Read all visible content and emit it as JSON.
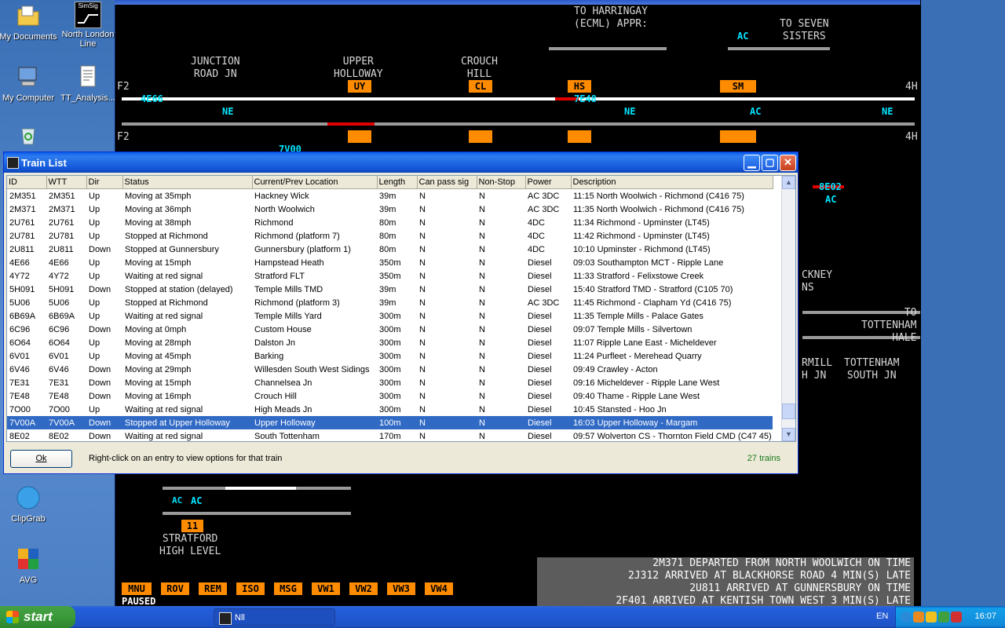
{
  "desktop": {
    "icons": [
      {
        "label": "My Documents",
        "name": "my-documents-icon"
      },
      {
        "label": "North London Line",
        "name": "simsig-icon"
      },
      {
        "label": "My Computer",
        "name": "my-computer-icon"
      },
      {
        "label": "TT_Analysis...",
        "name": "text-file-icon"
      },
      {
        "label": "ClipGrab",
        "name": "clipgrab-icon"
      },
      {
        "label": "AVG",
        "name": "avg-icon"
      }
    ],
    "simsig_icon_text": "SimSig"
  },
  "sim": {
    "labels": {
      "to_harringay": "TO HARRINGAY\n(ECML) APPR:",
      "to_seven_sisters": "TO SEVEN\nSISTERS",
      "junction_road": "JUNCTION\nROAD JN",
      "upper_holloway": "UPPER\nHOLLOWAY",
      "crouch_hill": "CROUCH\nHILL",
      "stratford_high_level": "STRATFORD\nHIGH LEVEL",
      "tottenham_south": "TOTTENHAM\nSOUTH JN",
      "to_tottenham_hale": "TO\nTOTTENHAM\nHALE",
      "hackney": "CKNEY\nNS",
      "rmill": "RMILL\nH JN",
      "harringay_partial": "HARRINGAY",
      "south_partial": "SOUTH",
      "f2_top": "F2",
      "f2_bottom": "F2",
      "h4_top": "4H",
      "h4_bottom": "4H"
    },
    "platforms": {
      "uy": "UY",
      "cl": "CL",
      "hs": "HS",
      "sm": "SM",
      "p11": "11"
    },
    "berths": {
      "b_4e66": "4E66",
      "b_7e48": "7E48",
      "b_8e02": "8E02",
      "b_7v00": "7V00",
      "ne1": "NE",
      "ne2": "NE",
      "ne3": "NE",
      "ac1": "AC",
      "ac2": "AC",
      "ac3": "AC",
      "ac4": "AC",
      "ac5": "AC"
    },
    "menu": [
      "MNU",
      "ROV",
      "REM",
      "ISO",
      "MSG",
      "VW1",
      "VW2",
      "VW3",
      "VW4"
    ],
    "status": "PAUSED",
    "messages": [
      "2M371 DEPARTED FROM NORTH WOOLWICH ON TIME",
      "2J312 ARRIVED AT BLACKHORSE ROAD 4 MIN(S) LATE",
      "2U811 ARRIVED AT GUNNERSBURY ON TIME",
      "2F401 ARRIVED AT KENTISH TOWN WEST 3 MIN(S) LATE"
    ]
  },
  "dialog": {
    "title": "Train List",
    "columns": [
      "ID",
      "WTT",
      "Dir",
      "Status",
      "Current/Prev Location",
      "Length",
      "Can pass sig",
      "Non-Stop",
      "Power",
      "Description"
    ],
    "rows": [
      [
        "2M351",
        "2M351",
        "Up",
        "Moving at 35mph",
        "Hackney Wick",
        "39m",
        "N",
        "N",
        "AC 3DC",
        "11:15 North Woolwich - Richmond (C416 75)"
      ],
      [
        "2M371",
        "2M371",
        "Up",
        "Moving at 36mph",
        "North Woolwich",
        "39m",
        "N",
        "N",
        "AC 3DC",
        "11:35 North Woolwich - Richmond (C416 75)"
      ],
      [
        "2U761",
        "2U761",
        "Up",
        "Moving at 38mph",
        "Richmond",
        "80m",
        "N",
        "N",
        "4DC",
        "11:34 Richmond - Upminster (LT45)"
      ],
      [
        "2U781",
        "2U781",
        "Up",
        "Stopped at Richmond",
        "Richmond (platform 7)",
        "80m",
        "N",
        "N",
        "4DC",
        "11:42 Richmond - Upminster (LT45)"
      ],
      [
        "2U811",
        "2U811",
        "Down",
        "Stopped at Gunnersbury",
        "Gunnersbury (platform 1)",
        "80m",
        "N",
        "N",
        "4DC",
        "10:10 Upminster - Richmond (LT45)"
      ],
      [
        "4E66",
        "4E66",
        "Up",
        "Moving at 15mph",
        "Hampstead Heath",
        "350m",
        "N",
        "N",
        "Diesel",
        "09:03 Southampton MCT - Ripple Lane"
      ],
      [
        "4Y72",
        "4Y72",
        "Up",
        "Waiting at red signal",
        "Stratford FLT",
        "350m",
        "N",
        "N",
        "Diesel",
        "11:33 Stratford - Felixstowe Creek"
      ],
      [
        "5H091",
        "5H091",
        "Down",
        "Stopped at station (delayed)",
        "Temple Mills TMD",
        "39m",
        "N",
        "N",
        "Diesel",
        "15:40 Stratford TMD - Stratford (C105 70)"
      ],
      [
        "5U06",
        "5U06",
        "Up",
        "Stopped at Richmond",
        "Richmond (platform 3)",
        "39m",
        "N",
        "N",
        "AC 3DC",
        "11:45 Richmond - Clapham Yd (C416 75)"
      ],
      [
        "6B69A",
        "6B69A",
        "Up",
        "Waiting at red signal",
        "Temple Mills Yard",
        "300m",
        "N",
        "N",
        "Diesel",
        "11:35 Temple Mills - Palace Gates"
      ],
      [
        "6C96",
        "6C96",
        "Down",
        "Moving at 0mph",
        "Custom House",
        "300m",
        "N",
        "N",
        "Diesel",
        "09:07 Temple Mills - Silvertown"
      ],
      [
        "6O64",
        "6O64",
        "Up",
        "Moving at 28mph",
        "Dalston Jn",
        "300m",
        "N",
        "N",
        "Diesel",
        "11:07 Ripple Lane East - Micheldever"
      ],
      [
        "6V01",
        "6V01",
        "Up",
        "Moving at 45mph",
        "Barking",
        "300m",
        "N",
        "N",
        "Diesel",
        "11:24 Purfleet - Merehead Quarry"
      ],
      [
        "6V46",
        "6V46",
        "Down",
        "Moving at 29mph",
        "Willesden South West Sidings",
        "300m",
        "N",
        "N",
        "Diesel",
        "09:49 Crawley - Acton"
      ],
      [
        "7E31",
        "7E31",
        "Down",
        "Moving at 15mph",
        "Channelsea Jn",
        "300m",
        "N",
        "N",
        "Diesel",
        "09:16 Micheldever - Ripple Lane West"
      ],
      [
        "7E48",
        "7E48",
        "Down",
        "Moving at 16mph",
        "Crouch Hill",
        "300m",
        "N",
        "N",
        "Diesel",
        "09:40 Thame - Ripple Lane West"
      ],
      [
        "7O00",
        "7O00",
        "Up",
        "Waiting at red signal",
        "High Meads Jn",
        "300m",
        "N",
        "N",
        "Diesel",
        "10:45 Stansted - Hoo Jn"
      ],
      [
        "7V00A",
        "7V00A",
        "Down",
        "Stopped at Upper Holloway",
        "Upper Holloway",
        "100m",
        "N",
        "N",
        "Diesel",
        "16:03 Upper Holloway - Margam"
      ],
      [
        "8E02",
        "8E02",
        "Down",
        "Waiting at red signal",
        "South Tottenham",
        "170m",
        "N",
        "N",
        "Diesel",
        "09:57 Wolverton CS - Thornton Field CMD (C47 45)"
      ]
    ],
    "selected_row": 17,
    "ok_label": "Ok",
    "hint": "Right-click on an entry to view options for that train",
    "count": "27 trains"
  },
  "taskbar": {
    "start_label": "start",
    "task_label": "Nll",
    "lang": "EN",
    "clock": "16:07"
  },
  "colors": {
    "platform": "#ff8c00",
    "berth": "#00e5ff",
    "selection": "#316ac5",
    "track_occupied": "#e00000"
  }
}
